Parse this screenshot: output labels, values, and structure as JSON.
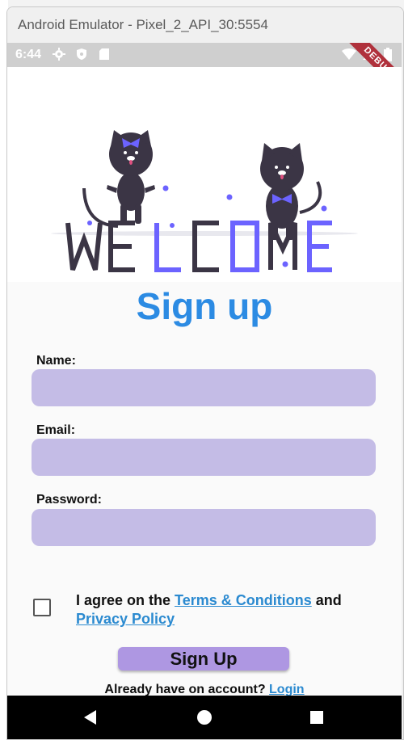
{
  "window": {
    "title": "Android Emulator - Pixel_2_API_30:5554"
  },
  "statusbar": {
    "time": "6:44",
    "debug_label": "DEBUG"
  },
  "hero": {
    "word": "WELCOME",
    "colors": {
      "dark": "#3b3545",
      "accent": "#6c63ff"
    }
  },
  "form": {
    "heading": "Sign up",
    "name_label": "Name:",
    "name_value": "",
    "email_label": "Email:",
    "email_value": "",
    "password_label": "Password:",
    "password_value": "",
    "agree_prefix": "I agree on the ",
    "terms_link": "Terms & Conditions",
    "agree_and": " and",
    "privacy_link": "Privacy Policy",
    "signup_label": "Sign Up",
    "already_text": "Already have on account? ",
    "login_link": "Login"
  },
  "colors": {
    "heading": "#2c8be3",
    "input_bg": "#c4bce6",
    "button_bg": "#ae97e2",
    "link": "#2b8ad0"
  },
  "nav": {
    "icons": [
      "back-icon",
      "home-icon",
      "recents-icon"
    ]
  }
}
